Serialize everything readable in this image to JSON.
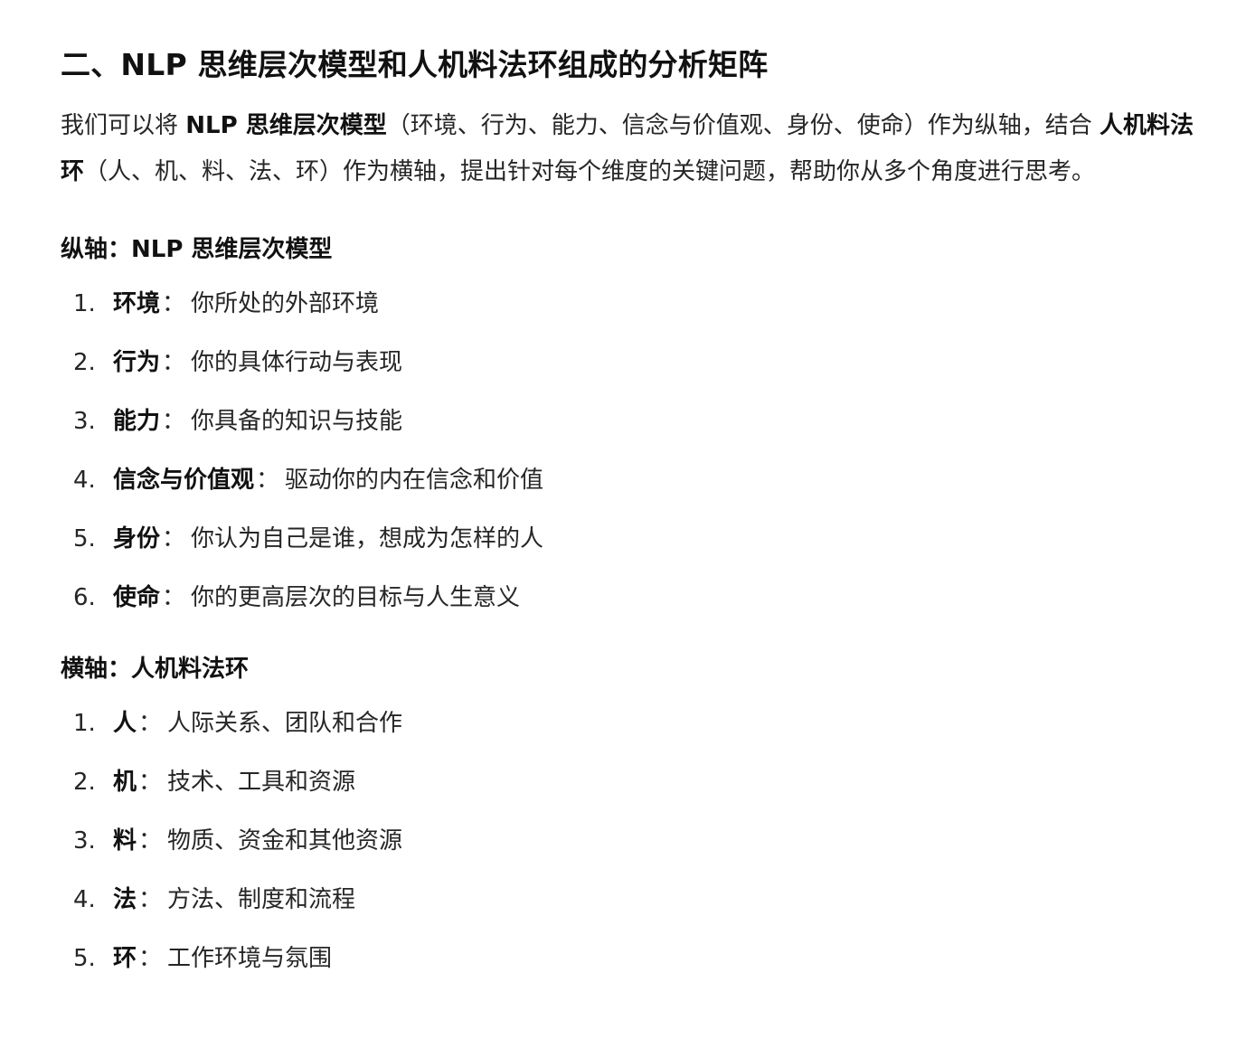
{
  "heading": "二、NLP 思维层次模型和人机料法环组成的分析矩阵",
  "intro": {
    "p1": "我们可以将 ",
    "b1": "NLP 思维层次模型",
    "p2": "（环境、行为、能力、信念与价值观、身份、使命）作为纵轴，结合 ",
    "b2": "人机料法环",
    "p3": "（人、机、料、法、环）作为横轴，提出针对每个维度的关键问题，帮助你从多个角度进行思考。"
  },
  "vertical": {
    "title": "纵轴：NLP 思维层次模型",
    "items": [
      {
        "num": "1.",
        "term": "环境",
        "desc": "你所处的外部环境"
      },
      {
        "num": "2.",
        "term": "行为",
        "desc": "你的具体行动与表现"
      },
      {
        "num": "3.",
        "term": "能力",
        "desc": "你具备的知识与技能"
      },
      {
        "num": "4.",
        "term": "信念与价值观",
        "desc": "驱动你的内在信念和价值"
      },
      {
        "num": "5.",
        "term": "身份",
        "desc": "你认为自己是谁，想成为怎样的人"
      },
      {
        "num": "6.",
        "term": "使命",
        "desc": "你的更高层次的目标与人生意义"
      }
    ]
  },
  "horizontal": {
    "title": "横轴：人机料法环",
    "items": [
      {
        "num": "1.",
        "term": "人",
        "desc": "人际关系、团队和合作"
      },
      {
        "num": "2.",
        "term": "机",
        "desc": "技术、工具和资源"
      },
      {
        "num": "3.",
        "term": "料",
        "desc": "物质、资金和其他资源"
      },
      {
        "num": "4.",
        "term": "法",
        "desc": "方法、制度和流程"
      },
      {
        "num": "5.",
        "term": "环",
        "desc": "工作环境与氛围"
      }
    ]
  },
  "colon": "："
}
